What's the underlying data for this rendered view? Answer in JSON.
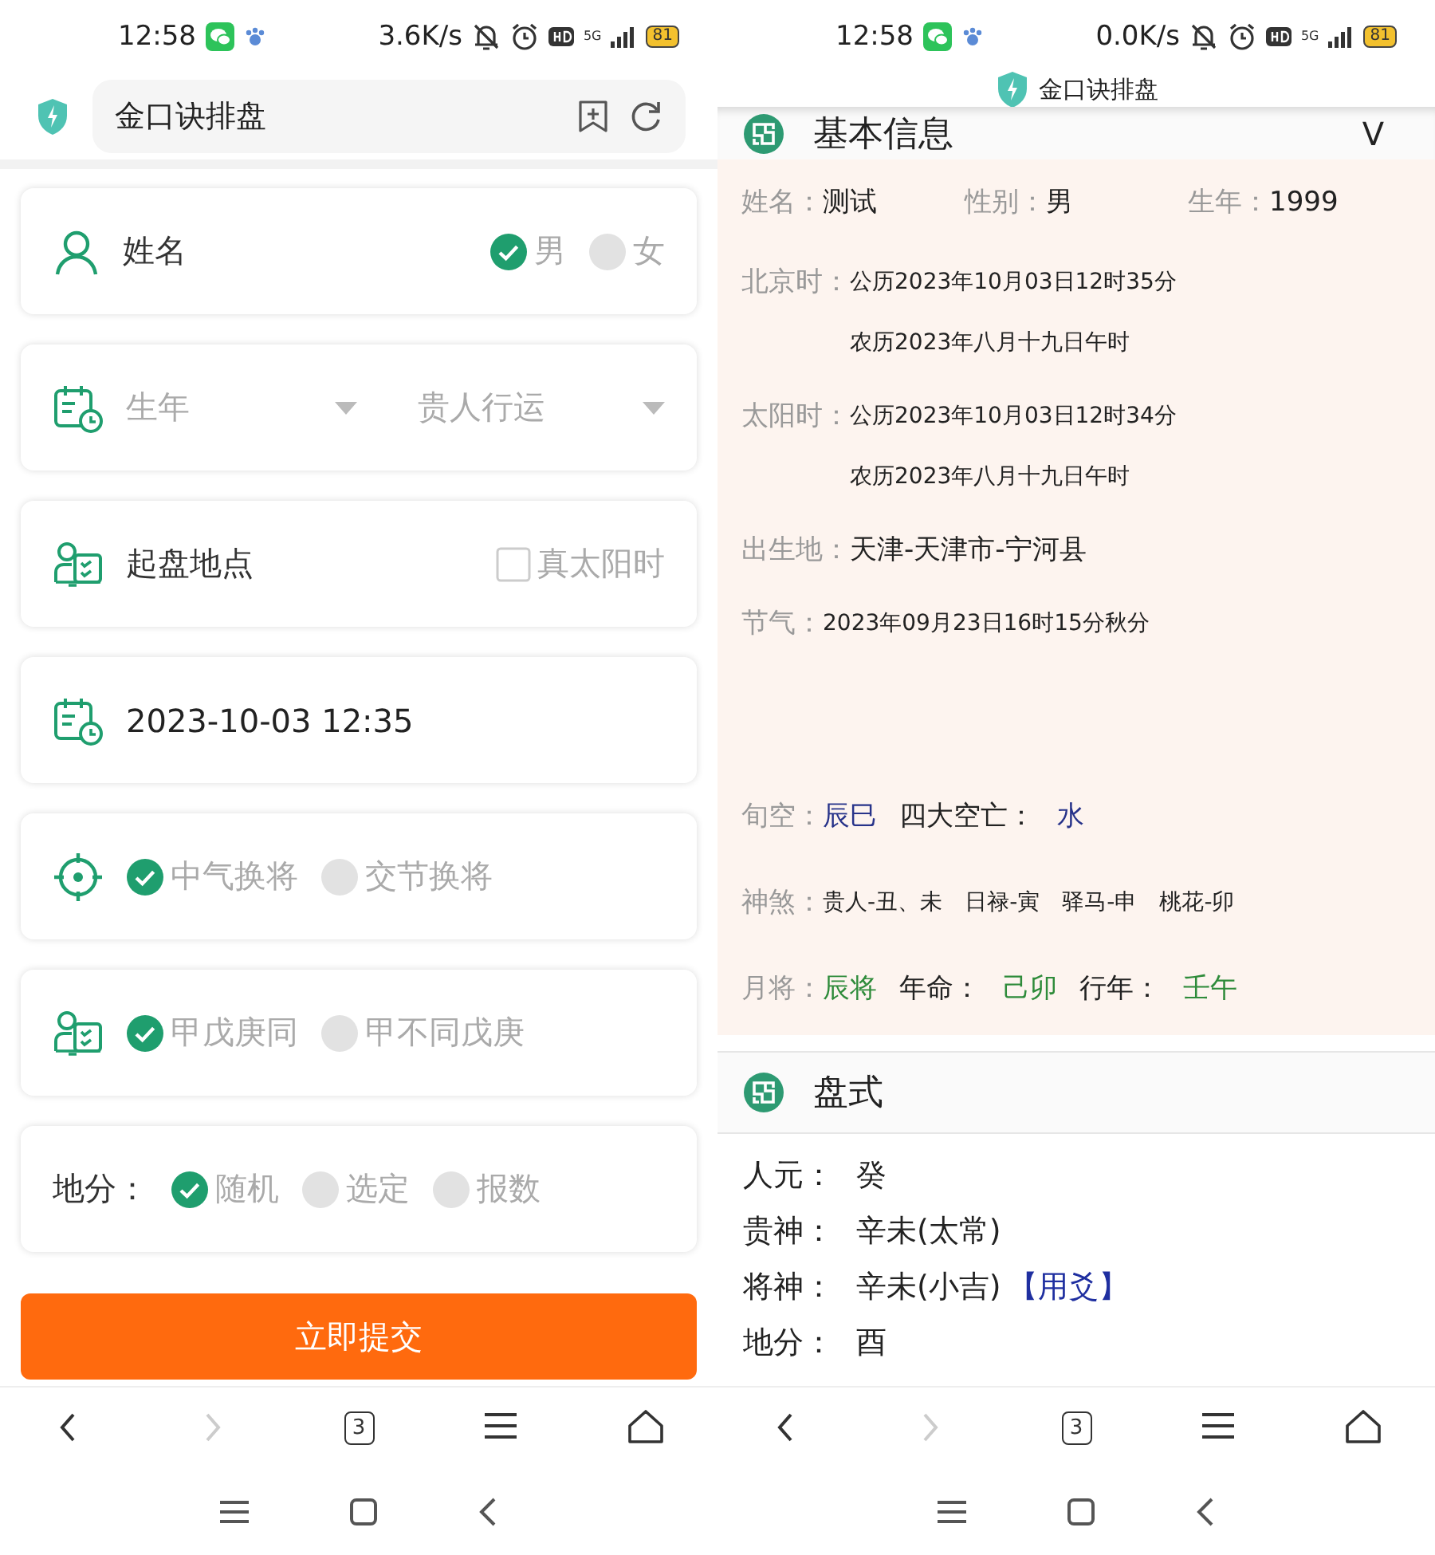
{
  "left_screen": {
    "status_bar": {
      "time": "12:58",
      "speed": "3.6K/s",
      "network": "5G",
      "battery": "81"
    },
    "address_bar": {
      "title": "金口诀排盘"
    },
    "cards": [
      {
        "kind": "name",
        "label": "姓名",
        "options": [
          {
            "label": "男",
            "selected": true
          },
          {
            "label": "女",
            "selected": false
          }
        ]
      },
      {
        "kind": "selects",
        "selects": [
          {
            "placeholder": "生年"
          },
          {
            "placeholder": "贵人行运"
          }
        ]
      },
      {
        "kind": "check",
        "label": "起盘地点",
        "checkbox": {
          "label": "真太阳时",
          "checked": false
        }
      },
      {
        "kind": "value",
        "value": "2023-10-03 12:35"
      },
      {
        "kind": "radios",
        "options": [
          {
            "label": "中气换将",
            "selected": true
          },
          {
            "label": "交节换将",
            "selected": false
          }
        ]
      },
      {
        "kind": "radios",
        "options": [
          {
            "label": "甲戊庚同",
            "selected": true
          },
          {
            "label": "甲不同戊庚",
            "selected": false
          }
        ]
      },
      {
        "kind": "radios",
        "label": "地分：",
        "options": [
          {
            "label": "随机",
            "selected": true
          },
          {
            "label": "选定",
            "selected": false
          },
          {
            "label": "报数",
            "selected": false
          }
        ]
      }
    ],
    "submit_button": "立即提交",
    "browser_nav": [
      {
        "kind": "back",
        "disabled": false
      },
      {
        "kind": "forward",
        "disabled": true
      },
      {
        "kind": "tabs",
        "label": "3",
        "disabled": false
      },
      {
        "kind": "menu",
        "disabled": false
      },
      {
        "kind": "home",
        "disabled": false
      }
    ]
  },
  "right_screen": {
    "status_bar": {
      "time": "12:58",
      "speed": "0.0K/s",
      "network": "5G",
      "battery": "81"
    },
    "title_bar": {
      "title": "金口诀排盘"
    },
    "basic_info": {
      "title": "基本信息",
      "toggle": "V",
      "rows": [
        {
          "kind": "fields",
          "fields": [
            {
              "label": "姓名：",
              "value": "测试"
            },
            {
              "label": "性别：",
              "value": "男"
            },
            {
              "label": "生年：",
              "value": "1999"
            }
          ]
        },
        {
          "kind": "lines",
          "label": "北京时：",
          "parts": [
            {
              "text": "公历2023年10月03日12时35分"
            },
            {
              "text": "农历2023年八月十九日午时"
            }
          ]
        },
        {
          "kind": "lines",
          "label": "太阳时：",
          "parts": [
            {
              "text": "公历2023年10月03日12时34分"
            },
            {
              "text": "农历2023年八月十九日午时"
            }
          ]
        },
        {
          "kind": "large",
          "label": "出生地：",
          "parts": [
            {
              "text": "天津-天津市-宁河县"
            }
          ]
        },
        {
          "kind": "lines",
          "label": "节气：",
          "parts": [
            {
              "text": "2023年09月23日16时15分秋分"
            }
          ]
        }
      ],
      "extra_rows": [
        {
          "kind": "large",
          "label": "旬空：",
          "parts": [
            {
              "text": "辰巳",
              "color": "#27338a"
            },
            {
              "text": "四大空亡：",
              "color": "#222222"
            },
            {
              "text": "水",
              "color": "#27338a"
            }
          ]
        },
        {
          "kind": "small",
          "label": "神煞：",
          "parts": [
            {
              "text": "贵人-丑、未"
            },
            {
              "text": "日禄-寅"
            },
            {
              "text": "驿马-申"
            },
            {
              "text": "桃花-卯"
            }
          ]
        },
        {
          "kind": "large",
          "label": "月将：",
          "parts": [
            {
              "text": "辰将",
              "color": "#2e8b3a"
            },
            {
              "text": "年命：",
              "color": "#222222"
            },
            {
              "text": "己卯",
              "color": "#2e8b3a"
            },
            {
              "text": "行年：",
              "color": "#222222"
            },
            {
              "text": "壬午",
              "color": "#2e8b3a"
            }
          ]
        }
      ]
    },
    "layout": {
      "title": "盘式",
      "rows": [
        {
          "label": "人元：",
          "parts": [
            {
              "text": "癸"
            }
          ]
        },
        {
          "label": "贵神：",
          "parts": [
            {
              "text": "辛未(太常)"
            }
          ]
        },
        {
          "label": "将神：",
          "parts": [
            {
              "text": "辛未(小吉)"
            },
            {
              "text": "【用爻】",
              "color": "#1f2fa0"
            }
          ]
        },
        {
          "label": "地分：",
          "parts": [
            {
              "text": "酉"
            }
          ]
        }
      ]
    },
    "browser_nav": [
      {
        "kind": "back",
        "disabled": false
      },
      {
        "kind": "forward",
        "disabled": true
      },
      {
        "kind": "tabs",
        "label": "3",
        "disabled": false
      },
      {
        "kind": "menu",
        "disabled": false
      },
      {
        "kind": "home",
        "disabled": false
      }
    ]
  }
}
